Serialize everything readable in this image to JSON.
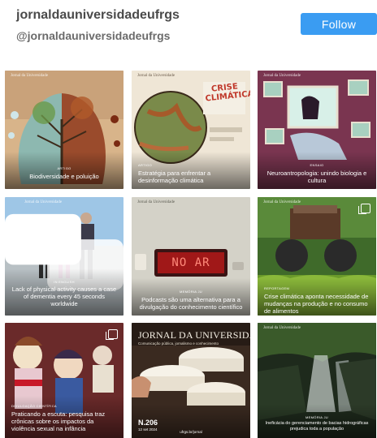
{
  "profile": {
    "username": "jornaldauniversidadeufrgs",
    "handle": "@jornaldauniversidadeufrgs",
    "follow_label": "Follow"
  },
  "brand": "Jornal da Universidade",
  "posts": [
    {
      "kicker": "Artigo",
      "caption": "Biodiversidade e poluição"
    },
    {
      "kicker": "Artigo",
      "caption": "Estratégia para enfrentar a desinformação climática",
      "art_text": "CRISE CLIMÁTICA"
    },
    {
      "kicker": "Ensaio",
      "caption": "Neuroantropologia: unindo biologia e cultura"
    },
    {
      "kicker": "In English",
      "caption": "Lack of physical activity causes a case of dementia every 45 seconds worldwide"
    },
    {
      "kicker": "Memória JU",
      "caption": "Podcasts são uma alternativa para a divulgação do conhecimento científico",
      "art_text": "NO AR"
    },
    {
      "kicker": "Reportagem",
      "caption": "Crise climática aponta necessidade de mudanças na produção e no consumo de alimentos"
    },
    {
      "kicker": "Divulgação científica",
      "caption": "Praticando a escuta: pesquisa traz crônicas sobre os impactos da violência sexual na infância"
    },
    {
      "kicker": "",
      "caption": "",
      "masthead": "JORNAL DA UNIVERSIDADE",
      "tagline": "Comunicação pública, jornalismo e conhecimento",
      "edition": "N.206",
      "date": "12 set 2024",
      "footer_site": "ufrgs.br/jornal"
    },
    {
      "kicker": "Memória JU",
      "caption": "Ineficácia do gerenciamento de bacias hidrográficas prejudica toda a população"
    }
  ]
}
